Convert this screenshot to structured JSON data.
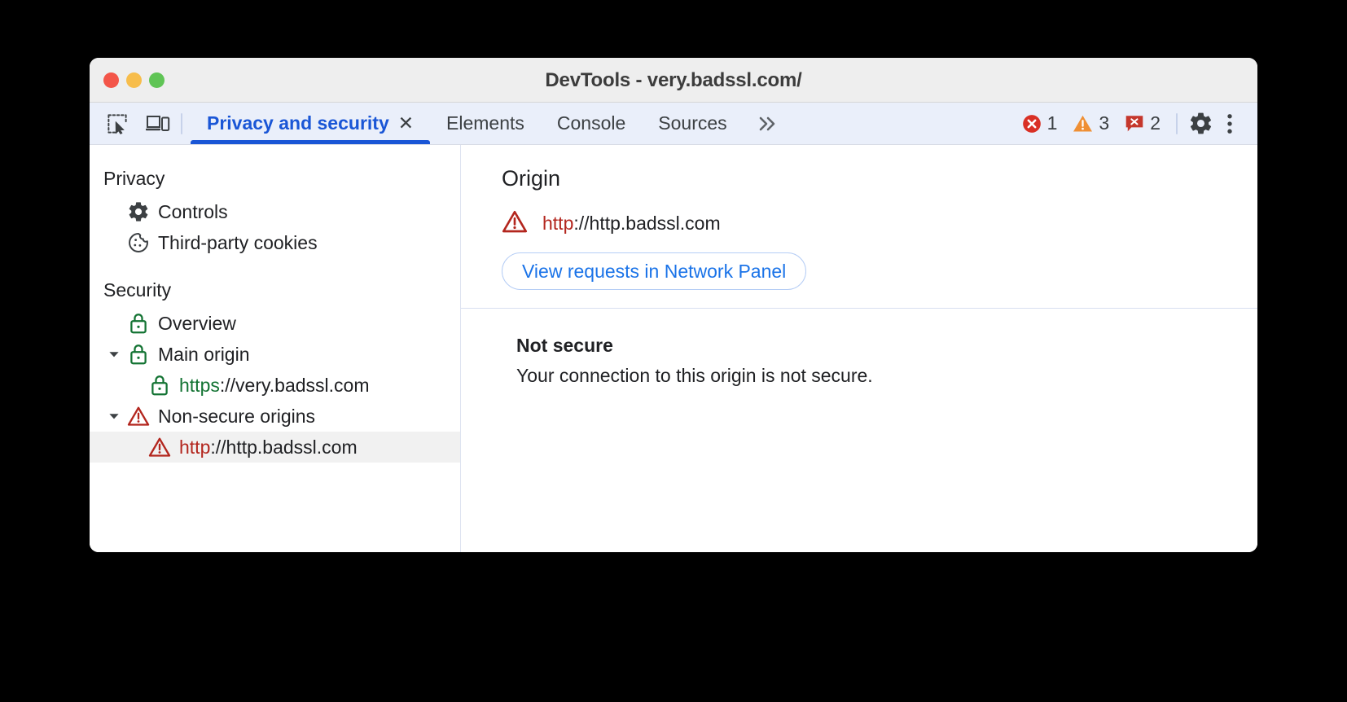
{
  "window": {
    "title": "DevTools - very.badssl.com/",
    "traffic_lights": [
      "close",
      "minimize",
      "maximize"
    ]
  },
  "toolbar": {
    "inspect_icon": "inspect-element-icon",
    "device_icon": "device-toolbar-icon",
    "tabs": [
      {
        "label": "Privacy and security",
        "active": true,
        "closable": true,
        "close_glyph": "✕"
      },
      {
        "label": "Elements",
        "active": false,
        "closable": false
      },
      {
        "label": "Console",
        "active": false,
        "closable": false
      },
      {
        "label": "Sources",
        "active": false,
        "closable": false
      }
    ],
    "more_tabs_glyph": "»",
    "counters": [
      {
        "name": "errors",
        "icon": "error-circle-icon",
        "count": "1",
        "color": "#d93025"
      },
      {
        "name": "warnings",
        "icon": "warning-triangle-icon",
        "count": "3",
        "color": "#ef8f34"
      },
      {
        "name": "issues",
        "icon": "issue-message-icon",
        "count": "2",
        "color": "#c5372c"
      }
    ],
    "settings_icon": "gear-icon",
    "more_icon": "kebab-menu-icon"
  },
  "sidebar": {
    "groups": [
      {
        "title": "Privacy",
        "items": [
          {
            "label": "Controls",
            "icon": "gear-icon",
            "indent": 1
          },
          {
            "label": "Third-party cookies",
            "icon": "cookie-icon",
            "indent": 1
          }
        ]
      },
      {
        "title": "Security",
        "items": [
          {
            "label": "Overview",
            "icon": "lock-green-icon",
            "indent": 1
          },
          {
            "label": "Main origin",
            "icon": "lock-green-icon",
            "indent": 0,
            "twisty": "▾"
          },
          {
            "label_scheme": "https",
            "label_rest": "://very.badssl.com",
            "icon": "lock-green-icon",
            "indent": 2,
            "scheme_color": "green"
          },
          {
            "label": "Non-secure origins",
            "icon": "warning-triangle-red-icon",
            "indent": 0,
            "twisty": "▾"
          },
          {
            "label_scheme": "http",
            "label_rest": "://http.badssl.com",
            "icon": "warning-triangle-red-icon",
            "indent": 2,
            "scheme_color": "red",
            "selected": true
          }
        ]
      }
    ]
  },
  "main": {
    "origin_heading": "Origin",
    "origin_scheme": "http",
    "origin_rest": "://http.badssl.com",
    "origin_icon": "warning-triangle-red-icon",
    "network_button": "View requests in Network Panel",
    "security_title": "Not secure",
    "security_description": "Your connection to this origin is not secure."
  },
  "colors": {
    "accent_blue": "#1a56d6",
    "link_blue": "#1a73e8",
    "secure_green": "#137333",
    "insecure_red": "#b3261e",
    "toolbar_bg": "#eaeffa",
    "titlebar_bg": "#eeeeee"
  }
}
